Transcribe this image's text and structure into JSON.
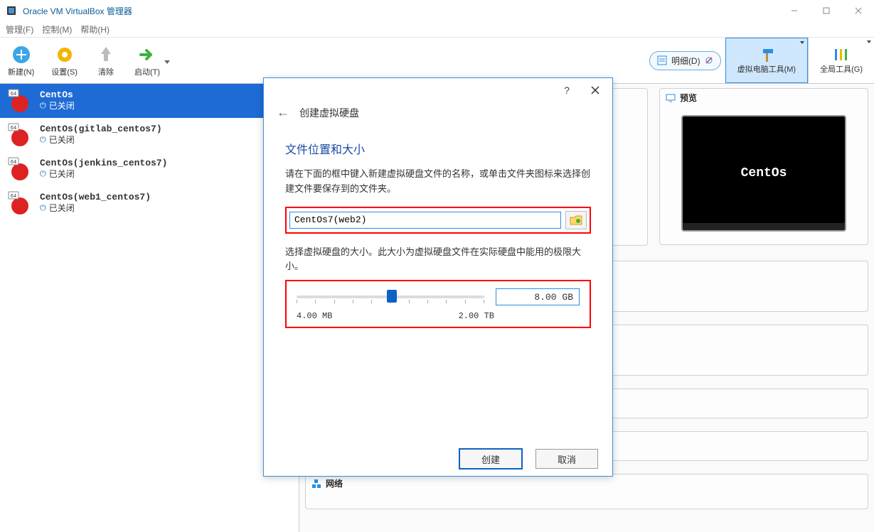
{
  "titlebar": {
    "title": "Oracle VM VirtualBox 管理器"
  },
  "menu": {
    "file": "管理(F)",
    "control": "控制(M)",
    "help": "帮助(H)"
  },
  "toolbar": {
    "new": "新建(N)",
    "settings": "设置(S)",
    "discard": "清除",
    "start": "启动(T)",
    "detail": "明细(D)",
    "vm_tools": "虚拟电脑工具(M)",
    "global_tools": "全局工具(G)"
  },
  "vms": [
    {
      "name": "CentOs",
      "status": "已关闭",
      "selected": true
    },
    {
      "name": "CentOs(gitlab_centos7)",
      "status": "已关闭",
      "selected": false
    },
    {
      "name": "CentOs(jenkins_centos7)",
      "status": "已关闭",
      "selected": false
    },
    {
      "name": "CentOs(web1_centos7)",
      "status": "已关闭",
      "selected": false
    }
  ],
  "preview": {
    "title": "预览",
    "vm_label": "CentOs"
  },
  "network_panel": {
    "title": "网络"
  },
  "dialog": {
    "header": "创建虚拟硬盘",
    "h1": "文件位置和大小",
    "desc1": "请在下面的框中键入新建虚拟硬盘文件的名称，或单击文件夹图标来选择创建文件要保存到的文件夹。",
    "filename": "CentOs7(web2)",
    "desc2": "选择虚拟硬盘的大小。此大小为虚拟硬盘文件在实际硬盘中能用的极限大小。",
    "size_value": "8.00 GB",
    "slider_min": "4.00 MB",
    "slider_max": "2.00 TB",
    "create": "创建",
    "cancel": "取消",
    "help": "?"
  }
}
